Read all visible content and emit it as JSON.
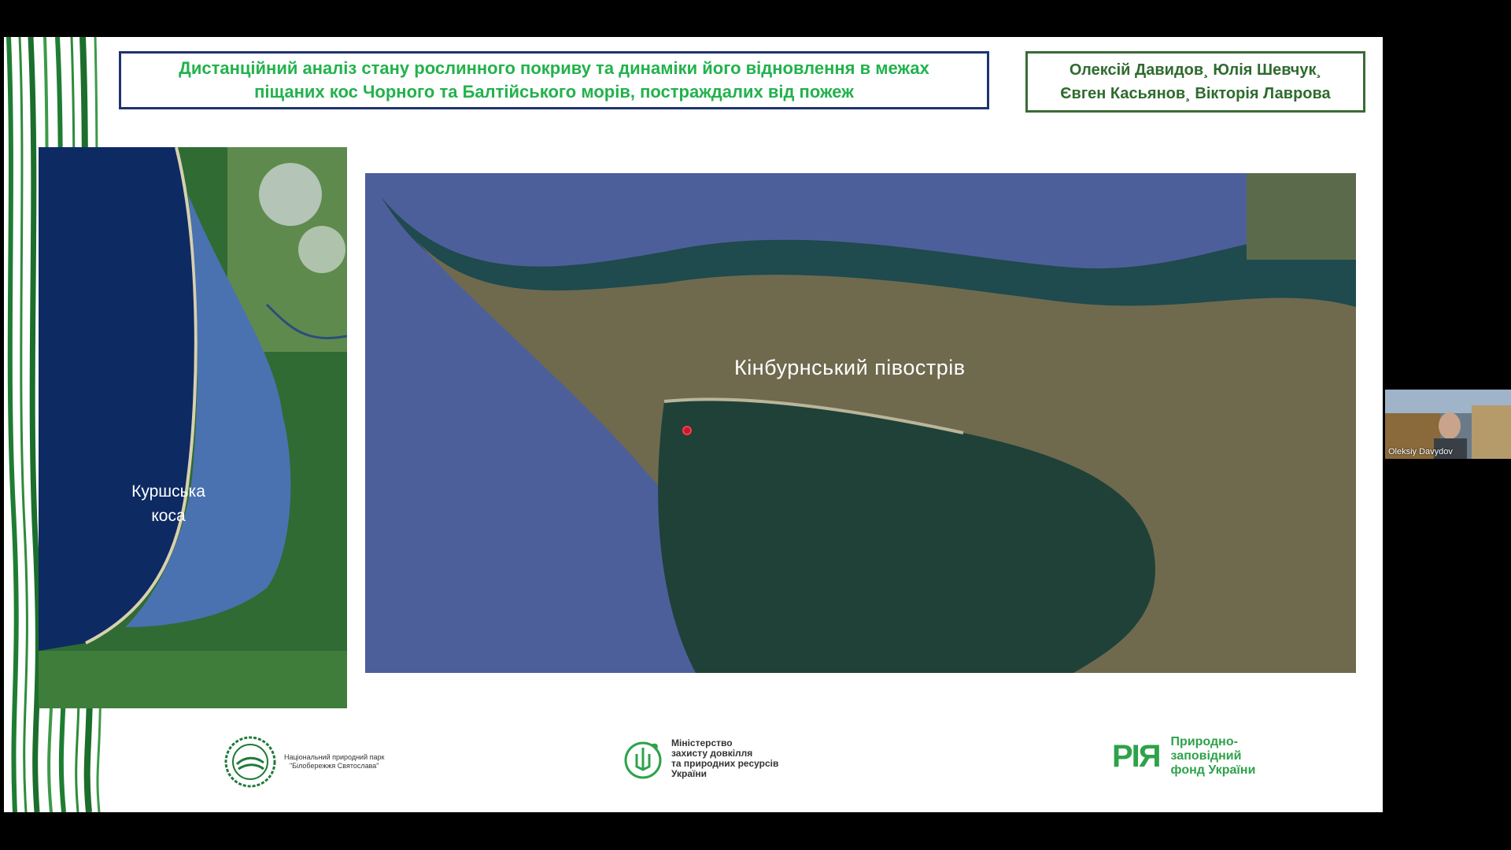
{
  "slide": {
    "title_line1": "Дистанційний аналіз стану рослинного покриву та динаміки його відновлення в межах",
    "title_line2": "піщаних кос Чорного та Балтійського морів, постраждалих від пожеж",
    "authors": {
      "line1": "Олексій Давидов¸ Юлія Шевчук¸",
      "line2": "Євген Касьянов¸ Вікторія Лаврова"
    },
    "baltic_map": {
      "label_line1": "Куршська",
      "label_line2": "коса"
    },
    "kinburn_map": {
      "label": "Кінбурнський півострів"
    },
    "logos": {
      "park_line1": "Національний природний парк",
      "park_line2": "\"Білобережжя Святослава\"",
      "ministry_line1": "Міністерство",
      "ministry_line2": "захисту довкілля",
      "ministry_line3": "та природних ресурсів",
      "ministry_line4": "України",
      "fund_mark": "РІЯ",
      "fund_line1": "Природно-",
      "fund_line2": "заповідний",
      "fund_line3": "фонд України"
    }
  },
  "webcam": {
    "participant_name": "Oleksiy Davydov"
  },
  "colors": {
    "title_green": "#22b24c",
    "title_border": "#1f3370",
    "authors_border": "#3a6b35",
    "sea_blue": "#4d5f9a"
  }
}
